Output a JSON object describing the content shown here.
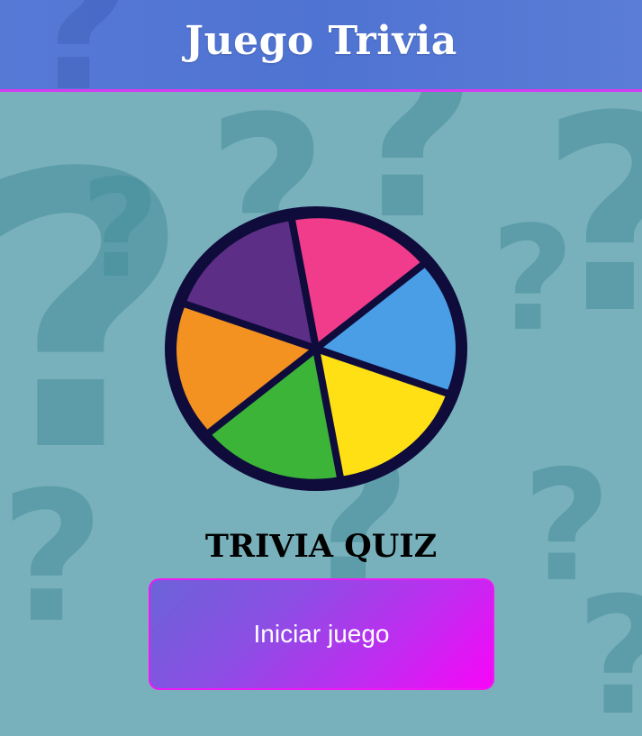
{
  "header": {
    "title": "Juego Trivia"
  },
  "logo": {
    "icon": "trivia-wheel-icon",
    "segments": [
      {
        "name": "pink",
        "color": "#f03c8a"
      },
      {
        "name": "blue",
        "color": "#4a9ee6"
      },
      {
        "name": "yellow",
        "color": "#ffe014"
      },
      {
        "name": "green",
        "color": "#3cb438"
      },
      {
        "name": "orange",
        "color": "#f39121"
      },
      {
        "name": "purple",
        "color": "#5c2e86"
      }
    ],
    "rim_color": "#0f0c3c"
  },
  "main": {
    "quiz_title": "TRIVIA QUIZ",
    "start_button_label": "Iniciar juego"
  },
  "colors": {
    "header_bg": "#4f73d2",
    "header_border": "#d43bf2",
    "page_bg": "#78b1bb",
    "button_gradient_start": "#6b63d8",
    "button_gradient_end": "#f806f8"
  }
}
